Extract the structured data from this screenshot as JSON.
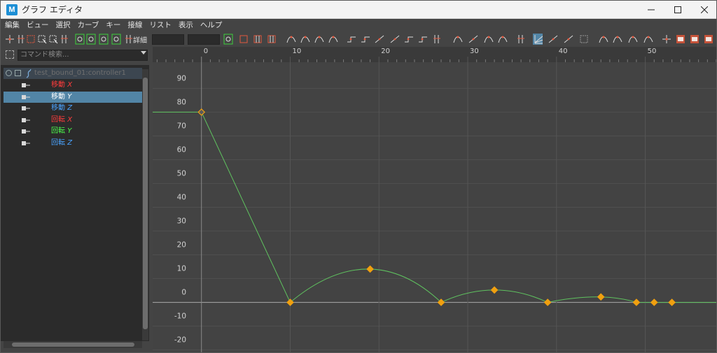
{
  "window": {
    "title": "グラフ エディタ",
    "app_icon_letter": "M"
  },
  "menu": [
    "編集",
    "ビュー",
    "選択",
    "カーブ",
    "キー",
    "接線",
    "リスト",
    "表示",
    "ヘルプ"
  ],
  "toolbar": {
    "detail_label": "詳細"
  },
  "outliner": {
    "search_placeholder": "コマンド検索...",
    "node": "test_bound_01:controller1",
    "attributes": [
      {
        "name": "移動",
        "axis": "X",
        "color": "#ff3c3c",
        "selected": false
      },
      {
        "name": "移動",
        "axis": "Y",
        "color": "#4cff4c",
        "selected": true
      },
      {
        "name": "移動",
        "axis": "Z",
        "color": "#4aa3ff",
        "selected": false
      },
      {
        "name": "回転",
        "axis": "X",
        "color": "#ff3c3c",
        "selected": false
      },
      {
        "name": "回転",
        "axis": "Y",
        "color": "#4cff4c",
        "selected": false
      },
      {
        "name": "回転",
        "axis": "Z",
        "color": "#4aa3ff",
        "selected": false
      }
    ]
  },
  "chart_data": {
    "type": "line",
    "xlim": [
      -5.5,
      58
    ],
    "ylim": [
      -21,
      101
    ],
    "x_ticks": [
      0,
      10,
      20,
      30,
      40,
      50
    ],
    "y_ticks": [
      90,
      80,
      70,
      60,
      50,
      40,
      30,
      20,
      10,
      0,
      -10,
      -20
    ],
    "grid": true,
    "series": [
      {
        "color": "#5fc25f",
        "keys": [
          {
            "x": 0,
            "y": 80,
            "selected": true
          },
          {
            "x": 10,
            "y": 0
          },
          {
            "x": 19,
            "y": 14
          },
          {
            "x": 27,
            "y": 0
          },
          {
            "x": 33,
            "y": 5.2
          },
          {
            "x": 39,
            "y": 0
          },
          {
            "x": 45,
            "y": 2.3
          },
          {
            "x": 49,
            "y": 0
          },
          {
            "x": 51,
            "y": 0
          },
          {
            "x": 53,
            "y": 0
          }
        ]
      }
    ]
  },
  "colors": {
    "key": "#f0a010",
    "curve": "#5fc25f",
    "graph_bg": "#434343"
  }
}
